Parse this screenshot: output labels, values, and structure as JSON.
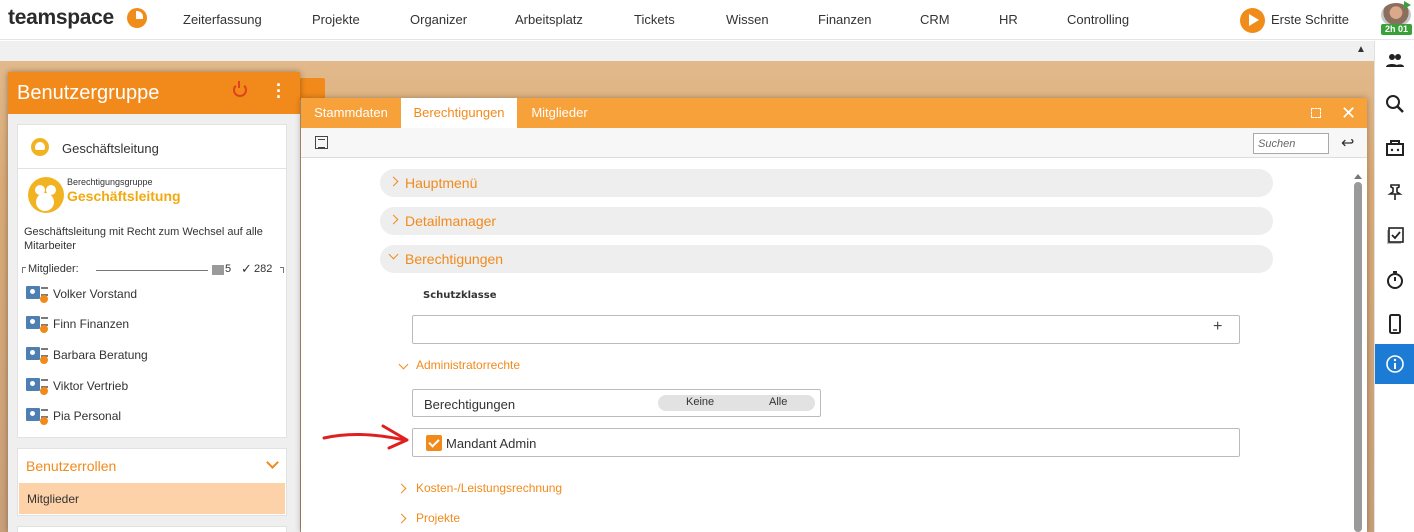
{
  "app": {
    "logo": "teamspace"
  },
  "nav": {
    "items": [
      "Zeiterfassung",
      "Projekte",
      "Organizer",
      "Arbeitsplatz",
      "Tickets",
      "Wissen",
      "Finanzen",
      "CRM",
      "HR",
      "Controlling"
    ],
    "start_label": "Erste Schritte",
    "timer": "2h 01"
  },
  "rail": {
    "icons": [
      "users-icon",
      "search-icon",
      "inbox-icon",
      "pin-icon",
      "tasks-icon",
      "stopwatch-icon",
      "mobile-icon",
      "info-icon"
    ],
    "active": "info-icon"
  },
  "left_panel": {
    "title": "Benutzergruppe",
    "group_short": "Geschäftsleitung",
    "group_type": "Berechtigungsgruppe",
    "group_name": "Geschäftsleitung",
    "description": "Geschäftsleitung mit Recht zum Wechsel auf alle Mitarbeiter",
    "members_label": "Mitglieder:",
    "members_count": "5",
    "members_check_count": "282",
    "members": [
      "Volker Vorstand",
      "Finn Finanzen",
      "Barbara Beratung",
      "Viktor Vertrieb",
      "Pia Personal"
    ],
    "roles_title": "Benutzerrollen",
    "roles_item": "Mitglieder"
  },
  "dialog": {
    "tabs": [
      "Stammdaten",
      "Berechtigungen",
      "Mitglieder"
    ],
    "active_tab": "Berechtigungen",
    "search_placeholder": "Suchen",
    "sections": [
      "Hauptmenü",
      "Detailmanager",
      "Berechtigungen"
    ],
    "field_label": "Schutzklasse",
    "field_plus": "+",
    "sub_admin": "Administratorrechte",
    "perm_label": "Berechtigungen",
    "toggle_none": "Keine",
    "toggle_all": "Alle",
    "checkbox_label": "Mandant Admin",
    "checkbox_checked": true,
    "sub_kosten": "Kosten-/Leistungsrechnung",
    "sub_projekte": "Projekte"
  },
  "colors": {
    "accent": "#f28a1b",
    "tabbar": "#f7a13a",
    "rail_active": "#1c7bd5",
    "annotation": "#e02020"
  }
}
